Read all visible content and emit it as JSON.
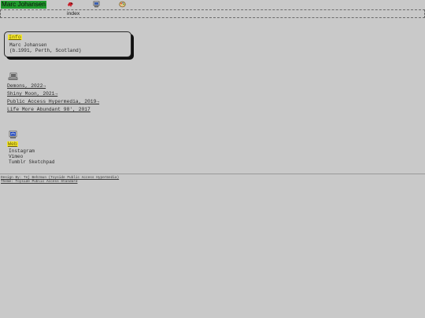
{
  "header": {
    "site_title": "Marc Johansen",
    "icons": [
      "red-bird-icon",
      "computer-icon",
      "palette-icon"
    ],
    "title_bg": "#1f9b2c"
  },
  "nav": {
    "index_label": "index"
  },
  "info": {
    "tag": "Info",
    "name": "Marc Johansen",
    "birth": "(b.1991, Perth, Scotland)"
  },
  "projects": {
    "icon": "projects-icon",
    "items": [
      "Demons, 2022→",
      "Shiny Moon, 2021→",
      "Public Access Hypermedia, 2019→",
      "Life More Abundant 98', 2017"
    ]
  },
  "web": {
    "icon": "web-icon",
    "tag": "Web",
    "items": [
      "Instagram",
      "Vimeo",
      "Tumblr Sketchpad"
    ]
  },
  "footer": {
    "credit_1": "Design By: Tej Behzmun (Toyside Public Access Hypermedia)",
    "credit_2": "Theme: Toyside Public Access Standard"
  },
  "colors": {
    "background": "#c9c9c9",
    "highlight": "#f1e52d",
    "title_green": "#1f9b2c"
  }
}
